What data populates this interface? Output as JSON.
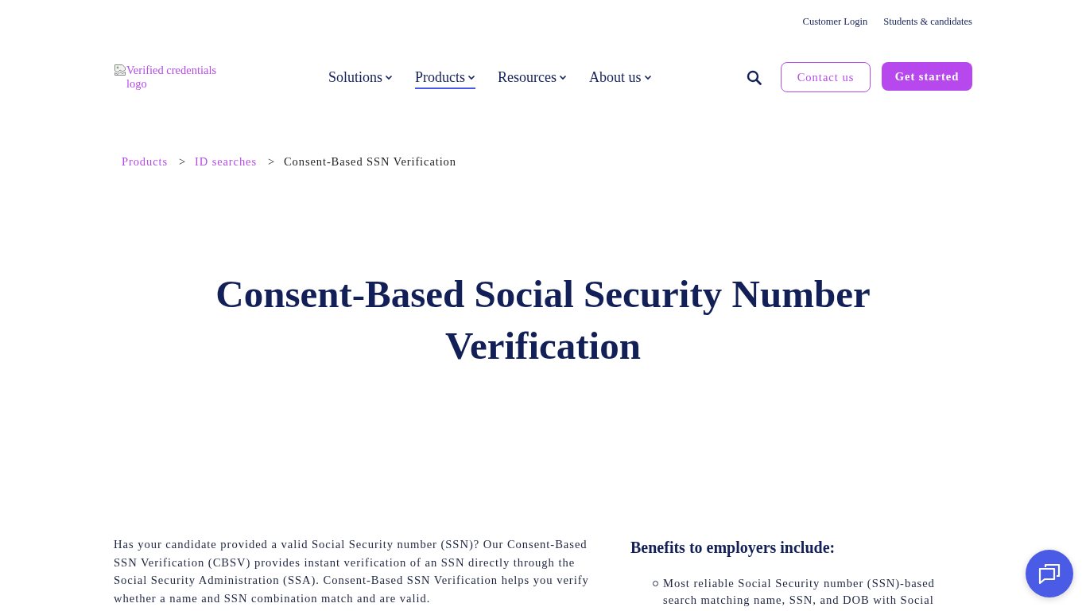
{
  "top_links": [
    {
      "label": "Customer Login"
    },
    {
      "label": "Students & candidates"
    }
  ],
  "header": {
    "logo": {
      "alt": "Verified credentials logo"
    },
    "nav": [
      {
        "label": "Solutions",
        "selected": false
      },
      {
        "label": "Products",
        "selected": true
      },
      {
        "label": "Resources",
        "selected": false
      },
      {
        "label": "About us",
        "selected": false
      }
    ],
    "buttons": [
      {
        "label": "Contact us",
        "kind": "outline"
      },
      {
        "label": "Get started",
        "kind": "filled"
      }
    ]
  },
  "breadcrumb": [
    {
      "label": "Products",
      "kind": "link"
    },
    {
      "label": ">",
      "kind": "separator"
    },
    {
      "label": "ID searches",
      "kind": "link"
    },
    {
      "label": ">",
      "kind": "separator"
    },
    {
      "label": "Consent-Based SSN Verification",
      "kind": "current"
    }
  ],
  "title": "Consent-Based Social Security Number Verification",
  "intro": "Has your candidate provided a valid Social Security number (SSN)? Our Consent-Based SSN Verification (CBSV) provides instant verification of an SSN directly through the Social Security Administration (SSA). Consent-Based SSN Verification helps you verify whether a name and SSN combination match and are valid.",
  "benefits": {
    "heading": "Benefits to employers include:",
    "items": [
      "Most reliable Social Security number (SSN)-based search matching name, SSN, and DOB with Social"
    ]
  }
}
